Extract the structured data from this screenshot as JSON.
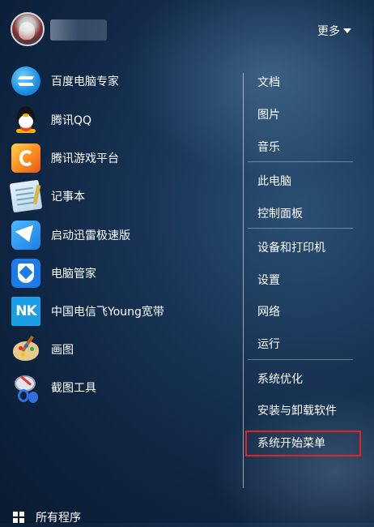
{
  "header": {
    "username": "",
    "more_label": "更多"
  },
  "programs": [
    {
      "label": "百度电脑专家",
      "icon": "baidu-icon"
    },
    {
      "label": "腾讯QQ",
      "icon": "qq-penguin-icon"
    },
    {
      "label": "腾讯游戏平台",
      "icon": "tencent-game-icon"
    },
    {
      "label": "记事本",
      "icon": "notepad-icon"
    },
    {
      "label": "启动迅雷极速版",
      "icon": "xunlei-icon"
    },
    {
      "label": "电脑管家",
      "icon": "pc-manager-shield-icon"
    },
    {
      "label": "中国电信飞Young宽带",
      "icon": "nk-icon",
      "icon_text": "NK"
    },
    {
      "label": "画图",
      "icon": "paint-palette-icon"
    },
    {
      "label": "截图工具",
      "icon": "snipping-tool-icon"
    }
  ],
  "right_menu": {
    "group1": [
      "文档",
      "图片",
      "音乐"
    ],
    "group2": [
      "此电脑",
      "控制面板"
    ],
    "group3": [
      "设备和打印机",
      "设置",
      "网络",
      "运行"
    ],
    "group4": [
      "系统优化",
      "安装与卸载软件",
      "系统开始菜单"
    ],
    "highlighted_item": "系统开始菜单",
    "highlight_color": "#e02424"
  },
  "footer": {
    "all_programs_label": "所有程序",
    "icon": "windows-logo-icon"
  }
}
